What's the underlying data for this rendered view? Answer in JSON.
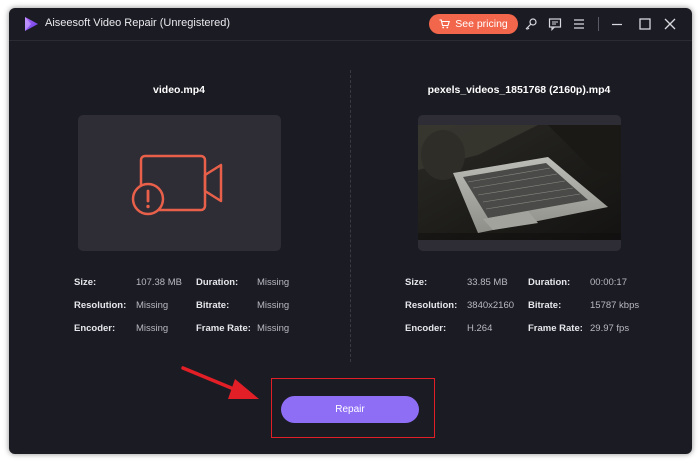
{
  "app": {
    "title": "Aiseesoft Video Repair (Unregistered)",
    "pricing_label": "See pricing"
  },
  "icons": [
    "app-logo-icon",
    "cart-icon",
    "key-icon",
    "feedback-icon",
    "menu-icon",
    "minimize-icon",
    "maximize-icon",
    "close-icon",
    "video-error-icon",
    "red-arrow-icon"
  ],
  "colors": {
    "window_bg": "#1b1b23",
    "pricing_bg": "#f2674c",
    "repair_bg": "#8f6ef6",
    "error_icon": "#e8604a",
    "highlight": "#e21f26"
  },
  "left_video": {
    "filename": "video.mp4",
    "size_label": "Size:",
    "size": "107.38 MB",
    "duration_label": "Duration:",
    "duration": "Missing",
    "resolution_label": "Resolution:",
    "resolution": "Missing",
    "bitrate_label": "Bitrate:",
    "bitrate": "Missing",
    "encoder_label": "Encoder:",
    "encoder": "Missing",
    "framerate_label": "Frame Rate:",
    "framerate": "Missing"
  },
  "right_video": {
    "filename": "pexels_videos_1851768 (2160p).mp4",
    "size_label": "Size:",
    "size": "33.85 MB",
    "duration_label": "Duration:",
    "duration": "00:00:17",
    "resolution_label": "Resolution:",
    "resolution": "3840x2160",
    "bitrate_label": "Bitrate:",
    "bitrate": "15787 kbps",
    "encoder_label": "Encoder:",
    "encoder": "H.264",
    "framerate_label": "Frame Rate:",
    "framerate": "29.97 fps"
  },
  "repair_label": "Repair"
}
